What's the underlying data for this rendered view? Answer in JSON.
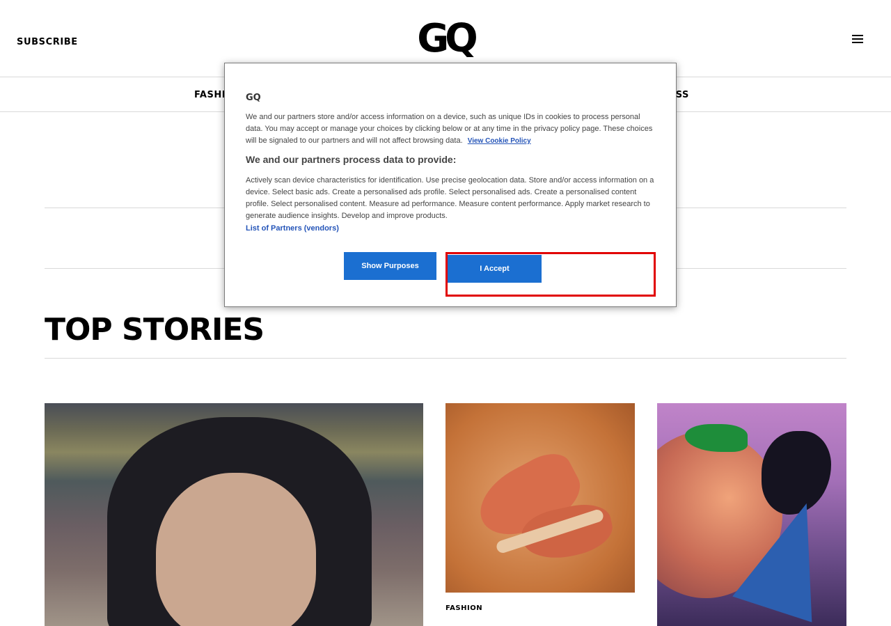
{
  "header": {
    "subscribe_label": "SUBSCRIBE",
    "logo_text": "GQ",
    "menu_icon": "hamburger-menu-icon"
  },
  "nav": {
    "left_item_visible": "FASHIO",
    "right_item_visible": "NESS"
  },
  "main": {
    "section_title": "TOP STORIES",
    "cards": [
      {
        "category": "",
        "image_desc": "portrait"
      },
      {
        "category": "FASHION",
        "image_desc": "orange sneakers"
      },
      {
        "category": "",
        "image_desc": "abstract illustration"
      }
    ]
  },
  "cookie_modal": {
    "brand": "GQ",
    "intro_text": "We and our partners store and/or access information on a device, such as unique IDs in cookies to process personal data. You may accept or manage your choices by clicking below or at any time in the privacy policy page. These choices will be signaled to our partners and will not affect browsing data.",
    "cookie_policy_link": "View Cookie Policy",
    "heading": "We and our partners process data to provide:",
    "purposes_text": "Actively scan device characteristics for identification. Use precise geolocation data. Store and/or access information on a device. Select basic ads. Create a personalised ads profile. Select personalised ads. Create a personalised content profile. Select personalised content. Measure ad performance. Measure content performance. Apply market research to generate audience insights. Develop and improve products.",
    "partners_link": "List of Partners (vendors)",
    "show_purposes_label": "Show Purposes",
    "accept_label": "I Accept",
    "colors": {
      "button": "#1b6fd1",
      "link": "#2454b8",
      "highlight": "#e10000"
    }
  }
}
